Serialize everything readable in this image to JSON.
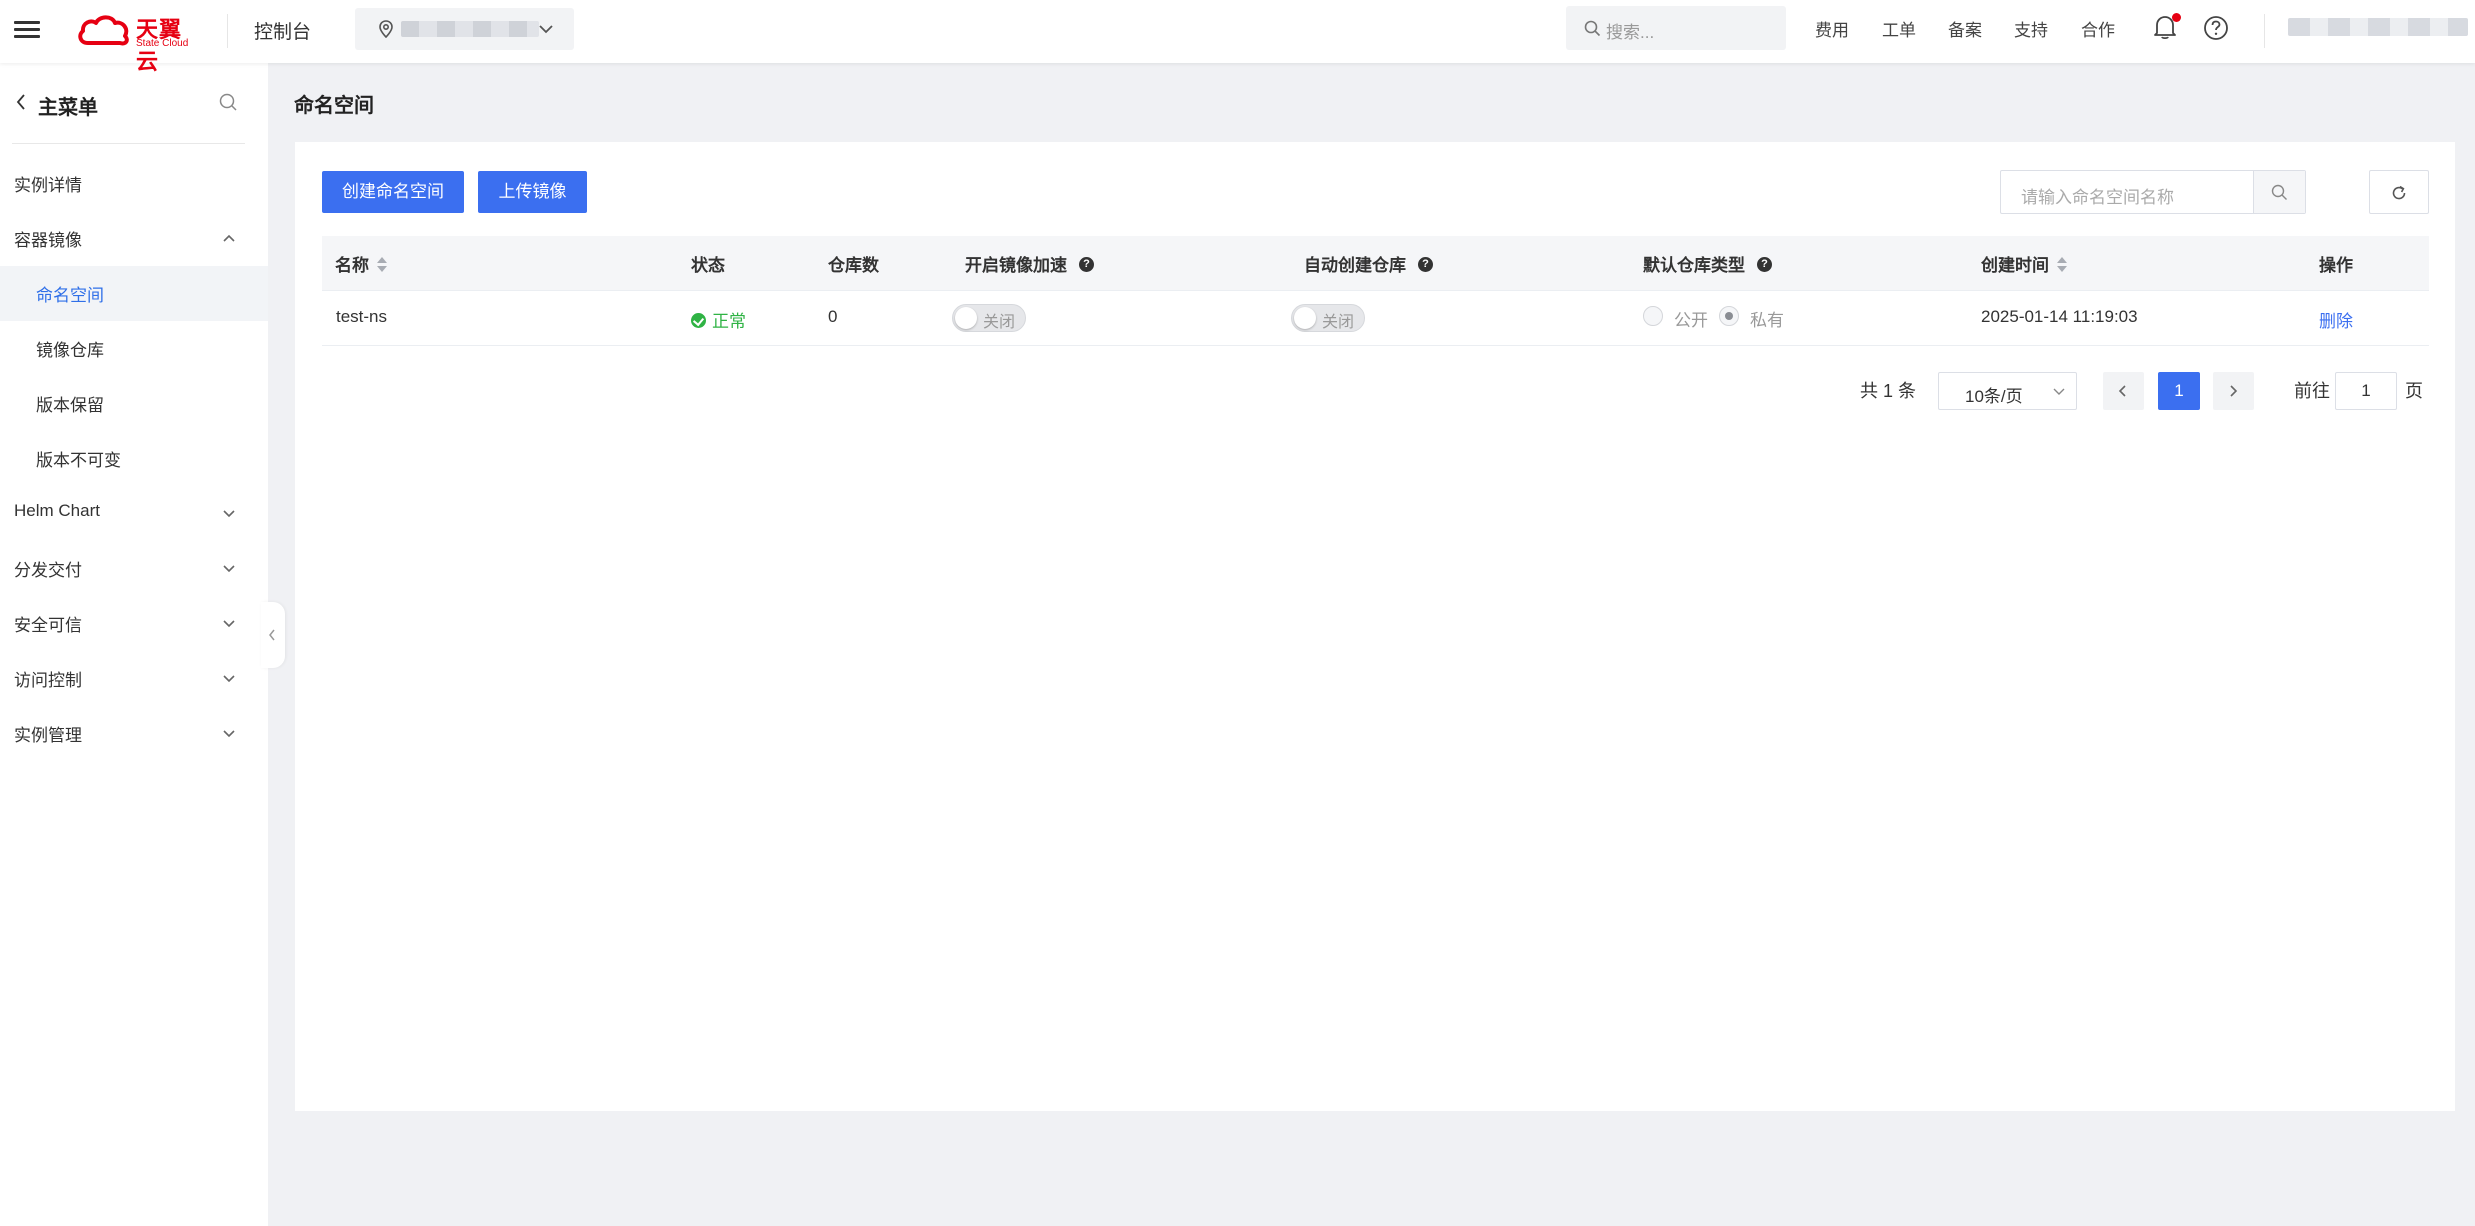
{
  "topbar": {
    "logo_text": "天翼云",
    "logo_sub": "State Cloud",
    "console_title": "控制台",
    "search_placeholder": "搜索...",
    "links": [
      "费用",
      "工单",
      "备案",
      "支持",
      "合作"
    ]
  },
  "sidebar": {
    "title": "主菜单",
    "items": [
      {
        "label": "实例详情"
      },
      {
        "label": "容器镜像",
        "expanded": true
      },
      {
        "label": "命名空间",
        "active": true
      },
      {
        "label": "镜像仓库"
      },
      {
        "label": "版本保留"
      },
      {
        "label": "版本不可变"
      },
      {
        "label": "Helm Chart"
      },
      {
        "label": "分发交付"
      },
      {
        "label": "安全可信"
      },
      {
        "label": "访问控制"
      },
      {
        "label": "实例管理"
      }
    ]
  },
  "main": {
    "page_title": "命名空间",
    "buttons": {
      "create": "创建命名空间",
      "upload": "上传镜像"
    },
    "search_placeholder": "请输入命名空间名称",
    "columns": [
      "名称",
      "状态",
      "仓库数",
      "开启镜像加速",
      "自动创建仓库",
      "默认仓库类型",
      "创建时间",
      "操作"
    ],
    "rows": [
      {
        "name": "test-ns",
        "status": "正常",
        "repo_count": "0",
        "accel": "关闭",
        "auto_create": "关闭",
        "repo_type_options": [
          "公开",
          "私有"
        ],
        "repo_type_selected": "私有",
        "created": "2025-01-14 11:19:03",
        "action": "删除"
      }
    ]
  },
  "pagination": {
    "total": "共 1 条",
    "page_size": "10条/页",
    "current": "1",
    "goto_label": "前往",
    "goto_value": "1",
    "page_label": "页"
  },
  "colors": {
    "primary": "#3b6ff0",
    "brand": "#e60012",
    "success": "#2fb344"
  }
}
